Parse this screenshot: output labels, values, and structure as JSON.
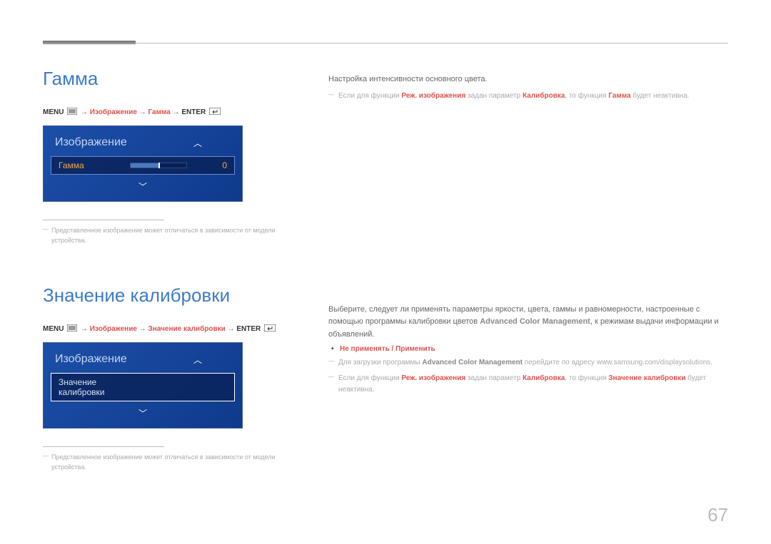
{
  "pageNumber": "67",
  "section1": {
    "title": "Гамма",
    "breadcrumb": {
      "menu": "MENU",
      "path1": "Изображение",
      "path2": "Гамма",
      "enter": "ENTER"
    },
    "osd": {
      "header": "Изображение",
      "rowLabel": "Гамма",
      "value": "0"
    },
    "note": "Представленное изображение может отличаться в зависимости от модели устройства.",
    "right": {
      "desc": "Настройка интенсивности основного цвета.",
      "note_pre": "Если для функции ",
      "note_b1": "Реж. изображения",
      "note_mid": " задан параметр ",
      "note_b2": "Калибровка",
      "note_mid2": ", то функция ",
      "note_b3": "Гамма",
      "note_end": " будет неактивна."
    }
  },
  "section2": {
    "title": "Значение калибровки",
    "breadcrumb": {
      "menu": "MENU",
      "path1": "Изображение",
      "path2": "Значение калибровки",
      "enter": "ENTER"
    },
    "osd": {
      "header": "Изображение",
      "rowLabel": "Значение калибровки"
    },
    "note": "Представленное изображение может отличаться в зависимости от модели устройства.",
    "right": {
      "desc_pre": "Выберите, следует ли применять параметры яркости, цвета, гаммы и равномерности, настроенные с помощью программы калибровки цветов ",
      "desc_b": "Advanced Color Management",
      "desc_post": ", к режимам выдачи информации и объявлений.",
      "bullet": "Не применять / Применить",
      "n1_pre": "Для загрузки программы ",
      "n1_b": "Advanced Color Management",
      "n1_post": " перейдите по адресу www.samsung.com/displaysolutions.",
      "n2_pre": "Если для функции ",
      "n2_b1": "Реж. изображения",
      "n2_mid": " задан параметр ",
      "n2_b2": "Калибровка",
      "n2_mid2": ", то функция ",
      "n2_b3": "Значение калибровки",
      "n2_end": " будет неактивна."
    }
  }
}
